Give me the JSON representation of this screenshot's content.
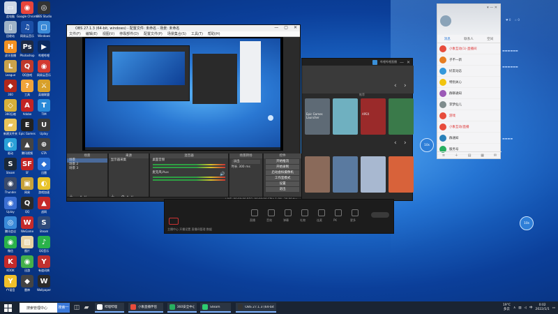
{
  "desktop": {
    "icons": [
      {
        "label": "此电脑",
        "color": "#cfd8e6",
        "glyph": "▭"
      },
      {
        "label": "Google Chrome",
        "color": "#e8453c",
        "glyph": "◉"
      },
      {
        "label": "OBS Studio",
        "color": "#333333",
        "glyph": "◎"
      },
      {
        "label": "回收站",
        "color": "#9fb3c8",
        "glyph": "▯"
      },
      {
        "label": "网易云音乐",
        "color": "#1b4fa6",
        "glyph": "♫"
      },
      {
        "label": "Windows",
        "color": "#3b8ad8",
        "glyph": "▢"
      },
      {
        "label": "虎牙直播",
        "color": "#f29122",
        "glyph": "H"
      },
      {
        "label": "Photoshop",
        "color": "#1e2a44",
        "glyph": "Ps"
      },
      {
        "label": "哔哩哔哩",
        "color": "#0a2a60",
        "glyph": "▶"
      },
      {
        "label": "League",
        "color": "#c9a24a",
        "glyph": "L"
      },
      {
        "label": "QQ游戏",
        "color": "#c0392b",
        "glyph": "Q"
      },
      {
        "label": "网易云音乐",
        "color": "#d33a31",
        "glyph": "◉"
      },
      {
        "label": "360",
        "color": "#b1281c",
        "glyph": "◆"
      },
      {
        "label": "工具",
        "color": "#f1a43b",
        "glyph": "?"
      },
      {
        "label": "英雄联盟",
        "color": "#d8a02a",
        "glyph": "⚔"
      },
      {
        "label": "360压缩",
        "color": "#d8b03a",
        "glyph": "◇"
      },
      {
        "label": "Adobe",
        "color": "#c22424",
        "glyph": "A"
      },
      {
        "label": "TIM",
        "color": "#2a8ad8",
        "glyph": "T"
      },
      {
        "label": "新建文件夹",
        "color": "#e8c45a",
        "glyph": "▰"
      },
      {
        "label": "Epic Games",
        "color": "#222222",
        "glyph": "E"
      },
      {
        "label": "Uplay",
        "color": "#3a3a3a",
        "glyph": "U"
      },
      {
        "label": "驱动",
        "color": "#2aa0d8",
        "glyph": "◐"
      },
      {
        "label": "腾讯视频",
        "color": "#444444",
        "glyph": "▲"
      },
      {
        "label": "GTA",
        "color": "#444444",
        "glyph": "⊕"
      },
      {
        "label": "Steam",
        "color": "#1b2838",
        "glyph": "S"
      },
      {
        "label": "SF",
        "color": "#c22424",
        "glyph": "SF"
      },
      {
        "label": "迅雷",
        "color": "#2b6fd3",
        "glyph": "◆"
      },
      {
        "label": "Thunder",
        "color": "#3a4a6a",
        "glyph": "◉"
      },
      {
        "label": "网易",
        "color": "#c8a23a",
        "glyph": "▣"
      },
      {
        "label": "游戏加速",
        "color": "#e8c32a",
        "glyph": "◐"
      },
      {
        "label": "Uplay",
        "color": "#3b6fd3",
        "glyph": "◉"
      },
      {
        "label": "QQ",
        "color": "#2a2a2a",
        "glyph": "Q"
      },
      {
        "label": "战网",
        "color": "#c52a2a",
        "glyph": "▲"
      },
      {
        "label": "腾讯会议",
        "color": "#3a8ad8",
        "glyph": "◎"
      },
      {
        "label": "WeGame",
        "color": "#c52a2a",
        "glyph": "W"
      },
      {
        "label": "Steam",
        "color": "#2f4a7a",
        "glyph": "S"
      },
      {
        "label": "微信",
        "color": "#2ab24a",
        "glyph": "◉"
      },
      {
        "label": "图片",
        "color": "#e8d3a3",
        "glyph": "▨"
      },
      {
        "label": "QQ音乐",
        "color": "#2ab24a",
        "glyph": "♪"
      },
      {
        "label": "KOOK",
        "color": "#c52a2a",
        "glyph": "K"
      },
      {
        "label": "迅游",
        "color": "#44b04a",
        "glyph": "◉"
      },
      {
        "label": "有道词典",
        "color": "#c03030",
        "glyph": "Y"
      },
      {
        "label": "YY语音",
        "color": "#f0c02a",
        "glyph": "Y"
      },
      {
        "label": "雷神",
        "color": "#444444",
        "glyph": "◆"
      },
      {
        "label": "Wallpaper",
        "color": "#2a2a2a",
        "glyph": "W"
      }
    ]
  },
  "obs": {
    "title": "OBS 27.1.3 (64-bit, windows) - 配置文件: 未命名 - 场景: 未命名",
    "menu": [
      "文件(F)",
      "编辑(E)",
      "视图(V)",
      "停靠部件(D)",
      "配置文件(P)",
      "场景集合(S)",
      "工具(T)",
      "帮助(H)"
    ],
    "panels": {
      "scenes": {
        "header": "场景",
        "items": [
          "场景",
          "场景 2",
          "场景 3"
        ]
      },
      "sources": {
        "header": "来源",
        "items": [
          "显示器采集"
        ]
      },
      "mixer": {
        "header": "混音器",
        "tracks": [
          "桌面音频",
          "麦克风/Aux"
        ]
      },
      "transitions": {
        "header": "场景转场",
        "type": "淡出",
        "duration_label": "时长",
        "duration": "300 ms"
      },
      "controls": {
        "header": "控件",
        "buttons": [
          "开始推流",
          "开始录制",
          "启动虚拟摄像机",
          "工作室模式",
          "设置",
          "退出"
        ]
      }
    },
    "status": "LIVE: 00:00:00  REC: 00:00:00  CPU: 1.0%, 30.00 fps"
  },
  "launcher": {
    "user": "哔哩哔哩直播",
    "section": "推荐",
    "tiles_row1": [
      {
        "color": "#5e6a75",
        "label": "Epic Games Launcher"
      },
      {
        "color": "#6fb0c0",
        "label": ""
      },
      {
        "color": "#9a2a2a",
        "label": "APEX"
      },
      {
        "color": "#3a7a4a",
        "label": ""
      }
    ],
    "tiles_row2": [
      {
        "color": "#8a6a5a",
        "label": ""
      },
      {
        "color": "#5a7aa0",
        "label": ""
      },
      {
        "color": "#a8b8d0",
        "label": ""
      },
      {
        "color": "#d8623a",
        "label": ""
      }
    ]
  },
  "streambar": {
    "items": [
      "直播",
      "音效",
      "弹幕",
      "礼物",
      "连麦",
      "PK",
      "更多"
    ],
    "bottom_text": "主播中心  开播设置  直播间管理  数据"
  },
  "chat": {
    "tabs": [
      "消息",
      "联系人",
      "空间"
    ],
    "items": [
      {
        "name": "小象互动(1)-直播间",
        "color": "#e74c3c",
        "red": true
      },
      {
        "name": "子不一新",
        "color": "#e67e22",
        "red": false
      },
      {
        "name": "好友动态",
        "color": "#3498db",
        "red": false
      },
      {
        "name": "特别关心",
        "color": "#f1c40f",
        "red": false
      },
      {
        "name": "群聊通知",
        "color": "#9b59b6",
        "red": false
      },
      {
        "name": "李梦仙儿",
        "color": "#7f8c8d",
        "red": false
      },
      {
        "name": "游戏",
        "color": "#e74c3c",
        "red": true
      },
      {
        "name": "小象互动/直播",
        "color": "#e74c3c",
        "red": true
      },
      {
        "name": "群通知",
        "color": "#2980b9",
        "red": false
      },
      {
        "name": "服务号",
        "color": "#27ae60",
        "red": false
      }
    ]
  },
  "timers": [
    "10s",
    "10s"
  ],
  "taskbar": {
    "search_placeholder": "搜索管理中心",
    "search_button": "搜索一下",
    "apps": [
      {
        "label": "哔哩哔哩",
        "color": "#ffffff"
      },
      {
        "label": "小象直播伴侣",
        "color": "#e74c3c"
      },
      {
        "label": "360安全中心",
        "color": "#27ae60"
      },
      {
        "label": "Steam",
        "color": "#2ecc71"
      },
      {
        "label": "OBS 27.1.3 (64-bit...",
        "color": "#333333"
      }
    ],
    "tray": {
      "weather": "19°C",
      "weather_sub": "多云",
      "time": "0:02",
      "date": "2022/1/1"
    }
  }
}
